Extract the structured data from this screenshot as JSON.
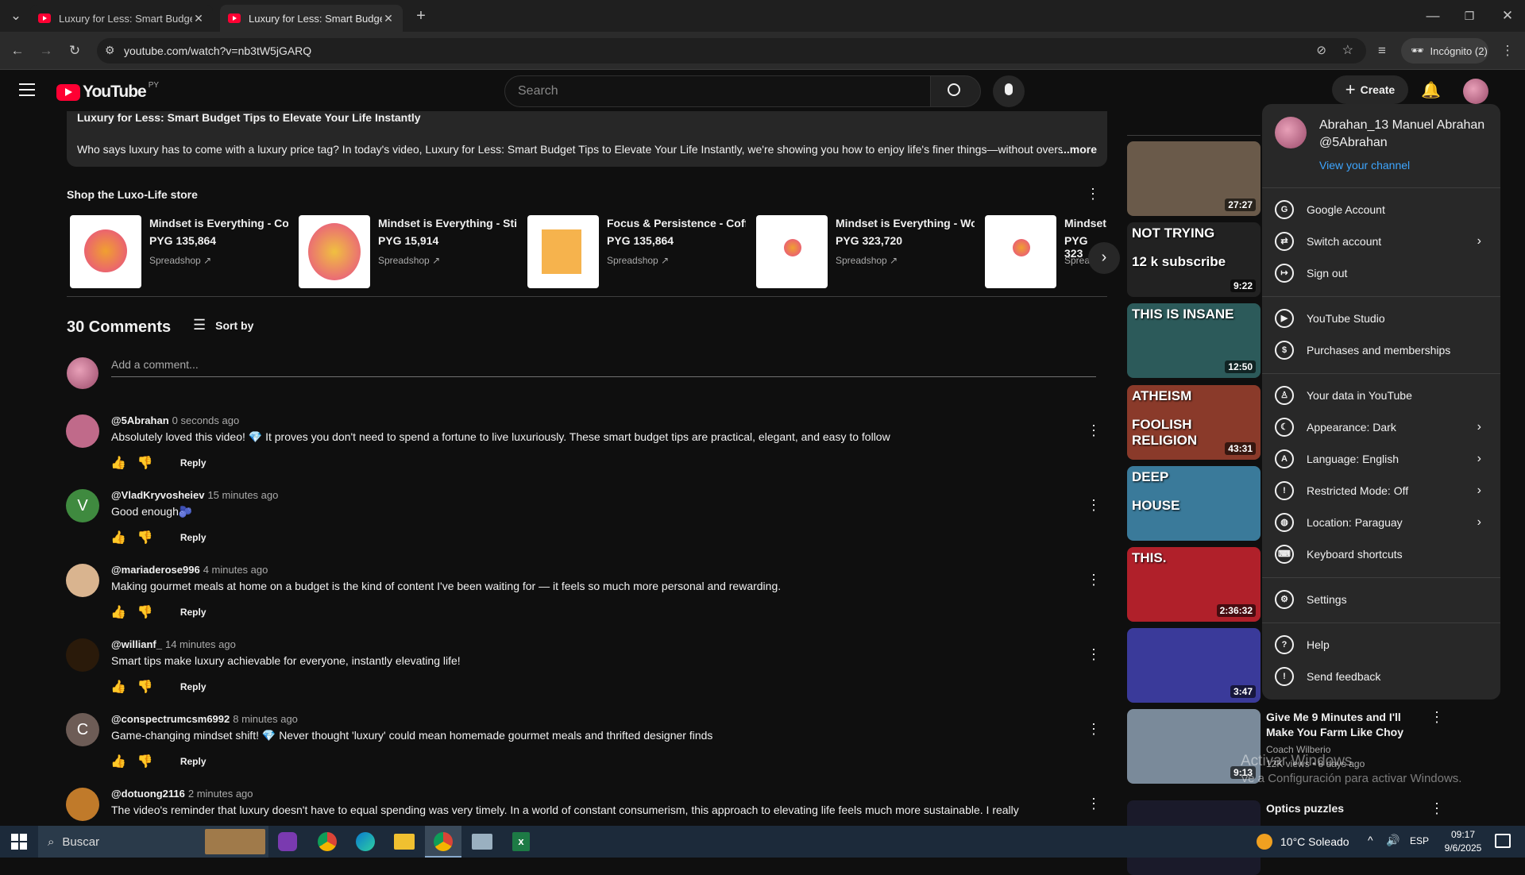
{
  "browser": {
    "tabs": [
      {
        "title": "Luxury for Less: Smart Budget T"
      },
      {
        "title": "Luxury for Less: Smart Budget T"
      }
    ],
    "url": "youtube.com/watch?v=nb3tW5jGARQ",
    "incognito_label": "Incógnito (2)"
  },
  "youtube": {
    "logo_text": "YouTube",
    "region": "PY",
    "search_placeholder": "Search",
    "create_label": "Create"
  },
  "description": {
    "title": "Luxury for Less: Smart Budget Tips to Elevate Your Life Instantly",
    "body": "Who says luxury has to come with a luxury price tag? In today's video, Luxury for Less: Smart Budget Tips to Elevate Your Life Instantly, we're showing you how to enjoy life's finer things—without oversp",
    "more": "...more"
  },
  "store": {
    "title": "Shop the Luxo-Life store",
    "products": [
      {
        "name": "Mindset is Everything - Co...",
        "price": "PYG 135,864",
        "seller": "Spreadshop"
      },
      {
        "name": "Mindset is Everything - Sti...",
        "price": "PYG 15,914",
        "seller": "Spreadshop"
      },
      {
        "name": "Focus & Persistence - Coff...",
        "price": "PYG 135,864",
        "seller": "Spreadshop"
      },
      {
        "name": "Mindset is Everything - Wo...",
        "price": "PYG 323,720",
        "seller": "Spreadshop"
      },
      {
        "name": "Mindset",
        "price": "PYG 323",
        "seller": "Sprea"
      }
    ]
  },
  "comments_section": {
    "count_label": "30 Comments",
    "sort_label": "Sort by",
    "add_placeholder": "Add a comment...",
    "reply_label": "Reply",
    "items": [
      {
        "author": "@5Abrahan",
        "time": "0 seconds ago",
        "text": "Absolutely loved this video! 💎 It proves you don't need to spend a fortune to live luxuriously. These smart budget tips are practical, elegant, and easy to follow",
        "avatar_color": "#c06a8a"
      },
      {
        "author": "@VladKryvosheiev",
        "time": "15 minutes ago",
        "text": "Good enough🫐",
        "avatar_color": "#3f8a3f",
        "avatar_letter": "V"
      },
      {
        "author": "@mariaderose996",
        "time": "4 minutes ago",
        "text": "Making gourmet meals at home on a budget is the kind of content I've been waiting for — it feels so much more personal and rewarding.",
        "avatar_color": "#d9b48f"
      },
      {
        "author": "@willianf_",
        "time": "14 minutes ago",
        "text": "Smart tips make luxury achievable for everyone, instantly elevating life!",
        "avatar_color": "#2a1a0a"
      },
      {
        "author": "@conspectrumcsm6992",
        "time": "8 minutes ago",
        "text": "Game-changing mindset shift! 💎 Never thought 'luxury' could mean homemade gourmet meals and thrifted designer finds",
        "avatar_color": "#6d5c56",
        "avatar_letter": "C"
      },
      {
        "author": "@dotuong2116",
        "time": "2 minutes ago",
        "text": "The video's reminder that luxury doesn't have to equal spending was very timely. In a world of constant consumerism, this approach to elevating life feels much more sustainable. I really",
        "avatar_color": "#c07a2a"
      }
    ]
  },
  "sidebar": {
    "videos": [
      {
        "duration": "27:27",
        "color": "#6a5a4a"
      },
      {
        "duration": "9:22",
        "color": "#222222",
        "overlay": "NOT TRYING",
        "overlay2": "12 k subscribe"
      },
      {
        "duration": "12:50",
        "color": "#2c5a5a",
        "overlay": "THIS IS INSANE"
      },
      {
        "duration": "43:31",
        "color": "#8a3a2a",
        "overlay": "ATHEISM",
        "overlay2": "FOOLISH RELIGION"
      },
      {
        "duration": "",
        "color": "#3a7a9a",
        "overlay": "DEEP",
        "overlay2": "HOUSE"
      },
      {
        "duration": "2:36:32",
        "color": "#b0202a",
        "overlay": "THIS."
      },
      {
        "duration": "3:47",
        "color": "#3a3a9a"
      },
      {
        "duration": "9:13",
        "color": "#7a8a9a",
        "title": "Give Me 9 Minutes and I'll Make You Farm Like Choy",
        "channel": "Coach Wilberio",
        "meta": "12K views • 8 days ago"
      },
      {
        "duration": "",
        "color": "#1a1a2a",
        "title": "Optics puzzles"
      }
    ]
  },
  "account_menu": {
    "name": "Abrahan_13 Manuel Abrahan",
    "handle": "@5Abrahan",
    "view_channel": "View your channel",
    "items": [
      {
        "label": "Google Account",
        "icon": "google-icon",
        "chevron": false
      },
      {
        "label": "Switch account",
        "icon": "switch-account-icon",
        "chevron": true
      },
      {
        "label": "Sign out",
        "icon": "sign-out-icon",
        "chevron": false
      },
      {
        "label": "YouTube Studio",
        "icon": "studio-icon",
        "chevron": false
      },
      {
        "label": "Purchases and memberships",
        "icon": "dollar-icon",
        "chevron": false
      },
      {
        "label": "Your data in YouTube",
        "icon": "shield-person-icon",
        "chevron": false
      },
      {
        "label": "Appearance: Dark",
        "icon": "moon-icon",
        "chevron": true
      },
      {
        "label": "Language: English",
        "icon": "translate-icon",
        "chevron": true
      },
      {
        "label": "Restricted Mode: Off",
        "icon": "restricted-icon",
        "chevron": true
      },
      {
        "label": "Location: Paraguay",
        "icon": "globe-icon",
        "chevron": true
      },
      {
        "label": "Keyboard shortcuts",
        "icon": "keyboard-icon",
        "chevron": false
      },
      {
        "label": "Settings",
        "icon": "gear-icon",
        "chevron": false
      },
      {
        "label": "Help",
        "icon": "help-icon",
        "chevron": false
      },
      {
        "label": "Send feedback",
        "icon": "feedback-icon",
        "chevron": false
      }
    ]
  },
  "watermark": {
    "line1": "Activar Windows",
    "line2": "Ve a Configuración para activar Windows."
  },
  "taskbar": {
    "search_placeholder": "Buscar",
    "weather": "10°C Soleado",
    "lang": "ESP",
    "time": "09:17",
    "date": "9/6/2025"
  },
  "colors": {
    "youtube_red": "#ff0033",
    "link_blue": "#3ea6ff",
    "bg": "#0f0f0f",
    "menu_bg": "#282828"
  }
}
